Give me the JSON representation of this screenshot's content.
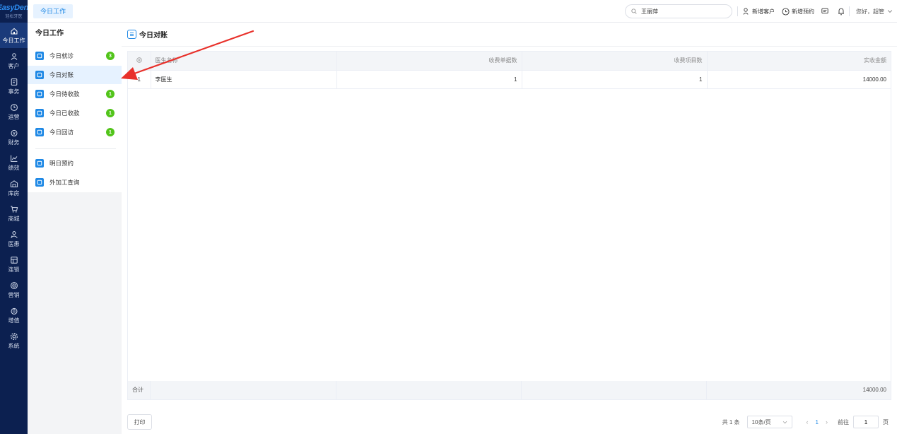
{
  "brand": {
    "name": "EasyDent",
    "subtitle": "轻松牙医"
  },
  "nav": {
    "items": [
      {
        "label": "今日工作",
        "icon": "home-icon"
      },
      {
        "label": "客户",
        "icon": "user-icon"
      },
      {
        "label": "事务",
        "icon": "task-icon"
      },
      {
        "label": "运营",
        "icon": "clock-icon"
      },
      {
        "label": "财务",
        "icon": "money-icon"
      },
      {
        "label": "绩效",
        "icon": "chart-icon"
      },
      {
        "label": "库房",
        "icon": "warehouse-icon"
      },
      {
        "label": "商城",
        "icon": "cart-icon"
      },
      {
        "label": "医患",
        "icon": "doctor-icon"
      },
      {
        "label": "连锁",
        "icon": "chain-icon"
      },
      {
        "label": "营销",
        "icon": "marketing-icon"
      },
      {
        "label": "增值",
        "icon": "gift-icon"
      },
      {
        "label": "系统",
        "icon": "gear-icon"
      }
    ]
  },
  "topbar": {
    "tab": "今日工作",
    "search_value": "王丽萍",
    "new_customer": "新增客户",
    "new_appointment": "新增预约",
    "greeting": "您好，超管"
  },
  "sidebar": {
    "title": "今日工作",
    "items": [
      {
        "label": "今日就诊",
        "badge": "3"
      },
      {
        "label": "今日对账",
        "badge": ""
      },
      {
        "label": "今日待收款",
        "badge": "1"
      },
      {
        "label": "今日已收款",
        "badge": "1"
      },
      {
        "label": "今日回访",
        "badge": "1"
      },
      {
        "label": "明日预约",
        "badge": ""
      },
      {
        "label": "外加工查询",
        "badge": ""
      }
    ]
  },
  "main": {
    "title": "今日对账",
    "table": {
      "columns": [
        "医生名称",
        "收费单据数",
        "收费项目数",
        "实收金额"
      ],
      "rows": [
        {
          "idx": "1",
          "doctor": "李医生",
          "bills": "1",
          "items": "1",
          "amount": "14000.00"
        }
      ],
      "sum_label": "合计",
      "sum_amount": "14000.00"
    },
    "print_label": "打印",
    "pager": {
      "total": "共 1 条",
      "page_size": "10条/页",
      "current": "1",
      "goto_label": "前往",
      "goto_value": "1",
      "page_unit": "页"
    }
  },
  "colors": {
    "nav_bg": "#0c2050",
    "accent": "#1e88e5",
    "badge": "#52c41a",
    "arrow": "#e8302a"
  }
}
